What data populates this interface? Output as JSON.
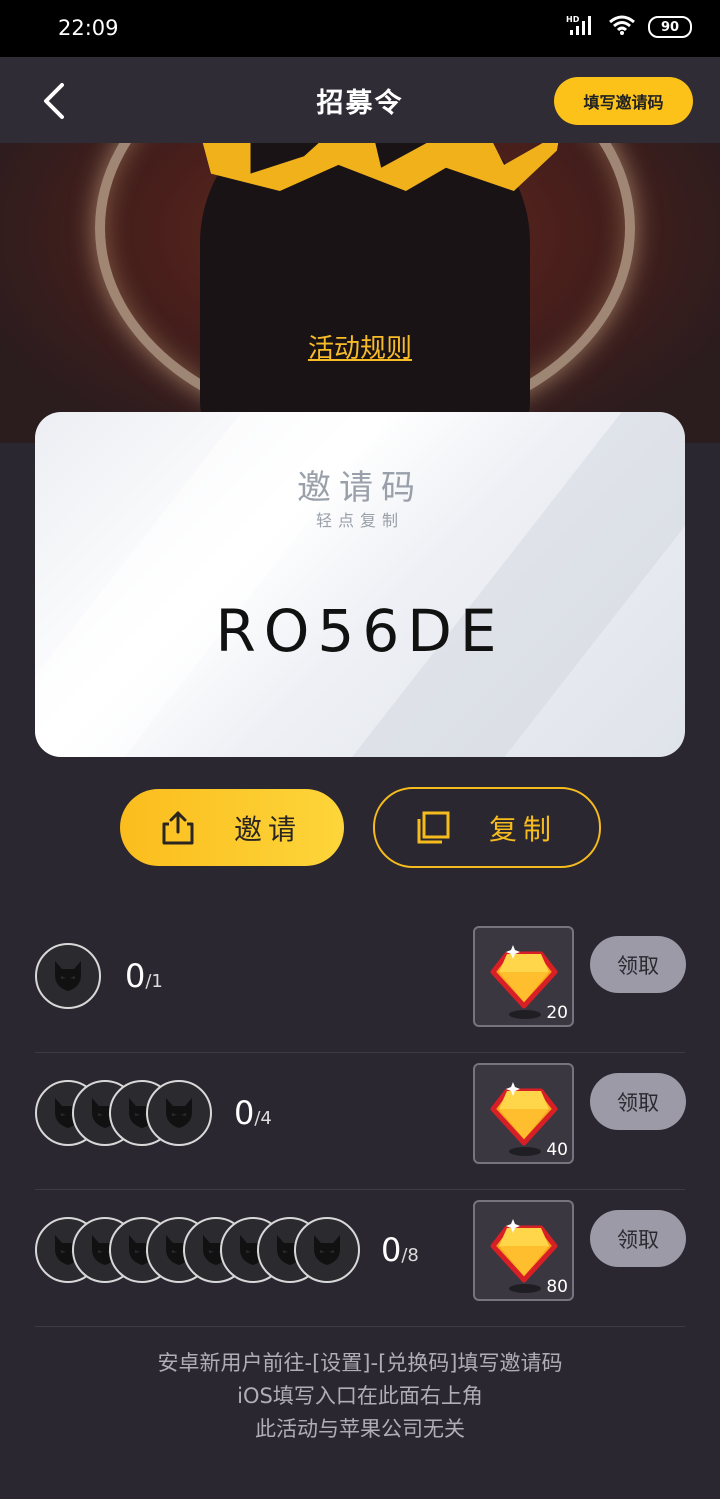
{
  "status_bar": {
    "time": "22:09",
    "signal": "HD",
    "battery": "90"
  },
  "navbar": {
    "title": "招募令",
    "fill_code_label": "填写邀请码"
  },
  "hero": {
    "rules_link": "活动规则"
  },
  "code_card": {
    "title": "邀请码",
    "subtitle": "轻点复制",
    "code": "RO56DE"
  },
  "actions": {
    "invite_label": "邀请",
    "copy_label": "复制"
  },
  "tiers": [
    {
      "current": "0",
      "total": "/1",
      "avatar_count": 1,
      "reward_amount": "20",
      "claim_label": "领取"
    },
    {
      "current": "0",
      "total": "/4",
      "avatar_count": 4,
      "reward_amount": "40",
      "claim_label": "领取"
    },
    {
      "current": "0",
      "total": "/8",
      "avatar_count": 8,
      "reward_amount": "80",
      "claim_label": "领取"
    }
  ],
  "footer": {
    "line1": "安卓新用户前往-[设置]-[兑换码]填写邀请码",
    "line2": "iOS填写入口在此面右上角",
    "line3": "此活动与苹果公司无关"
  },
  "colors": {
    "accent": "#fcc21a",
    "background": "#2a2730",
    "claim_button": "#9b9aa6"
  }
}
